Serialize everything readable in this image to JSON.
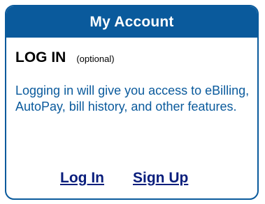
{
  "panel": {
    "title": "My Account",
    "login_heading": "LOG IN",
    "login_optional": "(optional)",
    "description": "Logging in will give you access to eBilling, AutoPay, bill history, and other features.",
    "links": {
      "login": "Log In",
      "signup": "Sign Up"
    }
  },
  "colors": {
    "accent": "#0a5a9c",
    "link": "#0a1e7c"
  }
}
